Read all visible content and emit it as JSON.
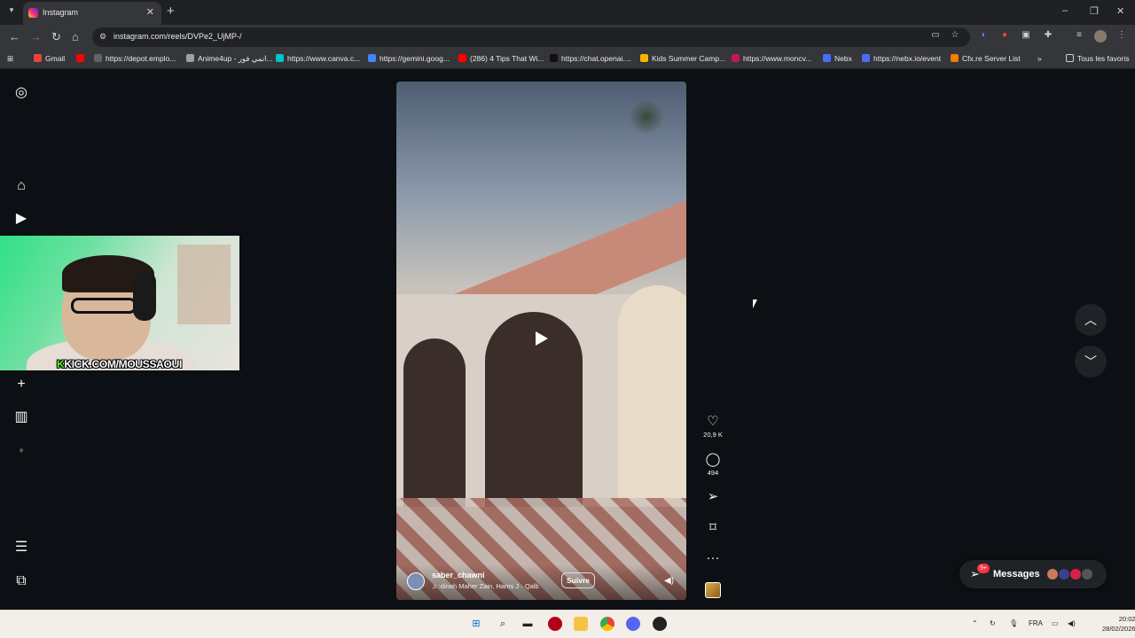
{
  "browser": {
    "tab": {
      "title": "Instagram",
      "close": "✕"
    },
    "new_tab": "+",
    "window_controls": {
      "minimize": "–",
      "restore": "❐",
      "close": "✕"
    },
    "nav": {
      "back": "←",
      "forward": "→",
      "reload": "↻",
      "home": "⌂"
    },
    "url": "instagram.com/reels/DVPe2_UjMP-/",
    "bookmarks": [
      {
        "label": "Gmail",
        "color": "#ea4335"
      },
      {
        "label": "",
        "color": "#ff0000"
      },
      {
        "label": "https://depot.emplo...",
        "color": "#5f6368"
      },
      {
        "label": "Anime4up - انمي فور...",
        "color": "#9aa0a6"
      },
      {
        "label": "https://www.canva.c...",
        "color": "#00c4cc"
      },
      {
        "label": "https://gemini.goog...",
        "color": "#4285f4"
      },
      {
        "label": "(286) 4 Tips That Wi...",
        "color": "#ff0000"
      },
      {
        "label": "https://chat.openai....",
        "color": "#111111"
      },
      {
        "label": "Kids Summer Camp...",
        "color": "#f5b400"
      },
      {
        "label": "https://www.moncv...",
        "color": "#c2185b"
      },
      {
        "label": "Nebx",
        "color": "#4a6cf7"
      },
      {
        "label": "https://nebx.io/event",
        "color": "#4a6cf7"
      },
      {
        "label": "Cfx.re Server List",
        "color": "#f57c00"
      }
    ],
    "bookmarks_more": "»",
    "all_bookmarks": "Tous les favoris"
  },
  "webcam": {
    "overlay_prefix": "K",
    "overlay_text": "KICK.COM/MOUSSAOUI"
  },
  "reel": {
    "username": "saber_chawni",
    "audio": "♫  :dinah  Maher Zain, Harris J · Qalb",
    "follow_label": "Suivre",
    "likes": "20,9 K",
    "comments": "494",
    "more": "···"
  },
  "messages": {
    "label": "Messages",
    "badge": "9+"
  },
  "taskbar": {
    "language": "FRA",
    "time": "20:02",
    "date": "28/02/2026"
  },
  "colors": {
    "accent": "#ff3040",
    "kick_green": "#53fc18",
    "background": "#0c1014"
  }
}
